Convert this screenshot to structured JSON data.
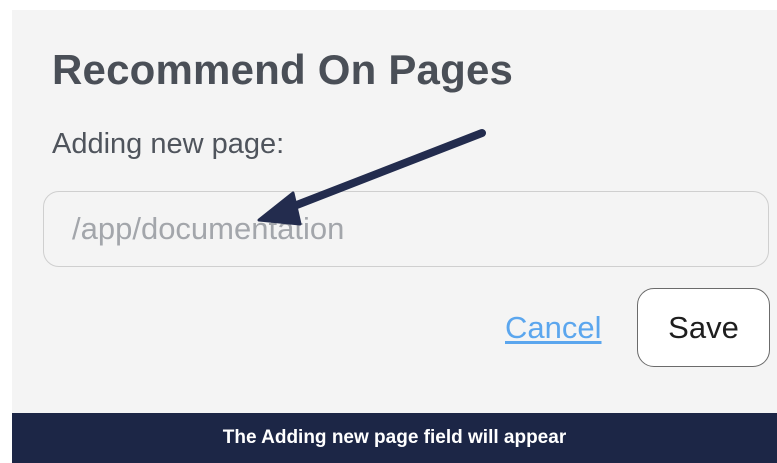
{
  "dialog": {
    "title": "Recommend On Pages",
    "field_label": "Adding new page:",
    "input_value": "",
    "input_placeholder": "/app/documentation",
    "cancel_label": "Cancel",
    "save_label": "Save"
  },
  "annotation": {
    "caption": "The Adding new page field will appear",
    "arrow_icon": "annotation-arrow-icon"
  },
  "colors": {
    "panel_background": "#f4f4f4",
    "title_text": "#4a4f57",
    "link": "#5ba6ee",
    "caption_bar": "#1c2646",
    "arrow": "#232c4e"
  }
}
